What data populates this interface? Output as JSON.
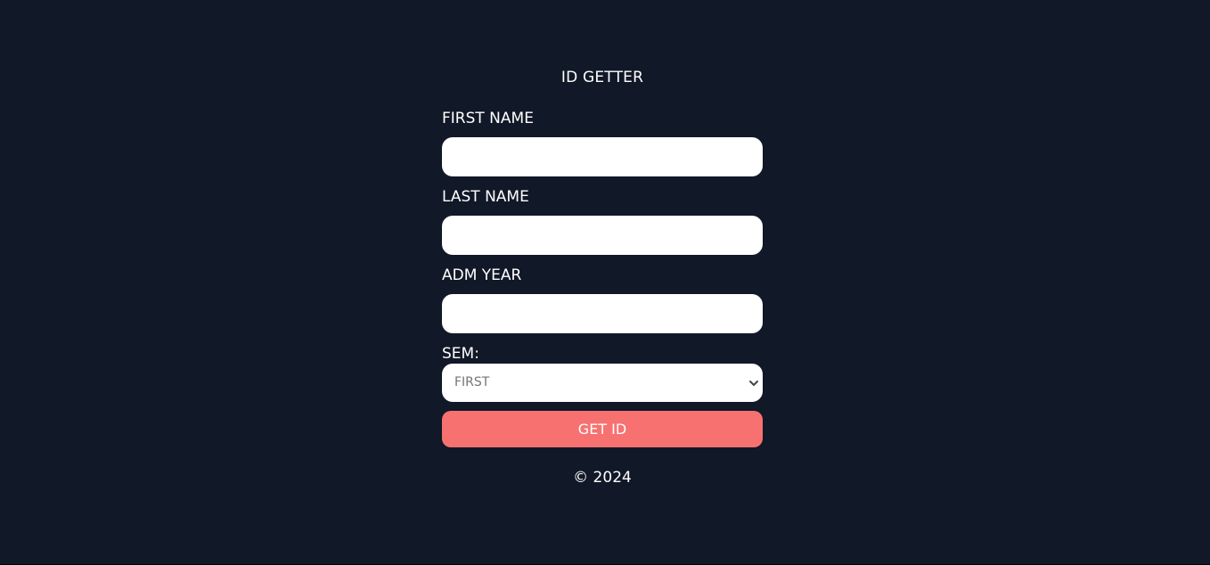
{
  "header": {
    "title": "ID GETTER"
  },
  "form": {
    "first_name": {
      "label": "FIRST NAME",
      "value": "",
      "placeholder": ""
    },
    "last_name": {
      "label": "LAST NAME",
      "value": "",
      "placeholder": ""
    },
    "adm_year": {
      "label": "ADM YEAR",
      "value": "",
      "placeholder": ""
    },
    "sem": {
      "label": "SEM:",
      "selected": "FIRST",
      "icon": "chevron-down-icon"
    },
    "submit_label": "GET ID"
  },
  "footer": {
    "text": "© 2024"
  },
  "colors": {
    "background": "#111827",
    "button": "#f87171",
    "input_background": "#ffffff",
    "text": "#ffffff"
  }
}
